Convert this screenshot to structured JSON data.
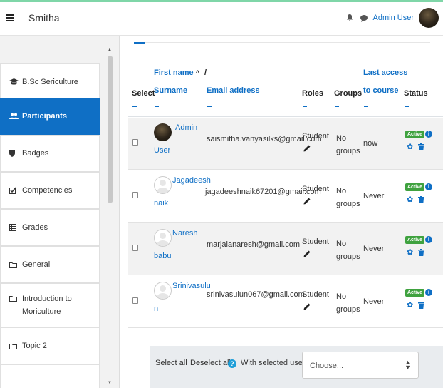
{
  "navbar": {
    "site_name": "Smitha",
    "user_name": "Admin User"
  },
  "drawer": {
    "items": [
      {
        "label": "B.Sc Sericulture",
        "icon": "graduation-cap-icon"
      },
      {
        "label": "Participants",
        "icon": "users-icon",
        "active": true
      },
      {
        "label": "Badges",
        "icon": "shield-icon"
      },
      {
        "label": "Competencies",
        "icon": "checkbox-icon"
      },
      {
        "label": "Grades",
        "icon": "table-icon"
      },
      {
        "label": "General",
        "icon": "folder-icon"
      },
      {
        "label": "Introduction to",
        "label2": "Moriculture",
        "icon": "folder-icon"
      },
      {
        "label": "Topic 2",
        "icon": "folder-icon"
      }
    ]
  },
  "table": {
    "headers": {
      "select": "Select",
      "first_name": "First name",
      "sort_arrow": "^",
      "slash": "/",
      "surname": "Surname",
      "email": "Email address",
      "roles": "Roles",
      "groups": "Groups",
      "last_access_1": "Last access",
      "last_access_2": "to course",
      "status": "Status"
    },
    "rows": [
      {
        "first": "Admin",
        "last": "User",
        "email": "saismitha.vanyasilks@gmail.com",
        "role": "Student",
        "groups1": "No",
        "groups2": "groups",
        "access": "now",
        "status": "Active"
      },
      {
        "first": "Jagadeesh",
        "last": "naik",
        "email": "jagadeeshnaik67201@gmail.com",
        "role": "Student",
        "groups1": "No",
        "groups2": "groups",
        "access": "Never",
        "status": "Active"
      },
      {
        "first": "Naresh",
        "last": "babu",
        "email": "marjalanaresh@gmail.com",
        "role": "Student",
        "groups1": "No",
        "groups2": "groups",
        "access": "Never",
        "status": "Active"
      },
      {
        "first": "Srinivasulu",
        "last": "n",
        "email": "srinivasulun067@gmail.com",
        "role": "Student",
        "groups1": "No",
        "groups2": "groups",
        "access": "Never",
        "status": "Active"
      }
    ]
  },
  "actions": {
    "select_all": "Select all",
    "deselect_all": "Deselect all",
    "help": "?",
    "with_selected": "With selected users...",
    "choose": "Choose..."
  },
  "colors": {
    "accent": "#0f6fc5",
    "active_badge": "#3fa23f",
    "top_border": "#7fd6a8"
  }
}
